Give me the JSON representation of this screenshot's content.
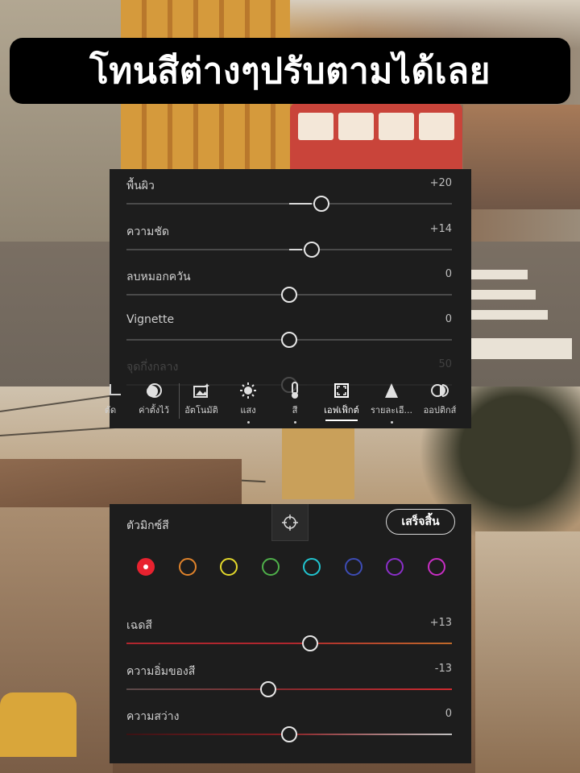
{
  "title": "โทนสีต่างๆปรับตามได้เลย",
  "top_panel": {
    "sliders": [
      {
        "label": "พื้นผิว",
        "value": "+20",
        "level": 20
      },
      {
        "label": "ความชัด",
        "value": "+14",
        "level": 14
      },
      {
        "label": "ลบหมอกควัน",
        "value": "0",
        "level": 0
      },
      {
        "label": "Vignette",
        "value": "0",
        "level": 0
      },
      {
        "label": "จุดกึ่งกลาง",
        "value": "50",
        "level": 0
      }
    ],
    "toolbar": [
      {
        "label": "ตัด",
        "icon": "crop-icon"
      },
      {
        "label": "ค่าตั้งไว้",
        "icon": "presets-icon"
      },
      {
        "label": "อัตโนมัติ",
        "icon": "auto-icon"
      },
      {
        "label": "แสง",
        "icon": "light-icon"
      },
      {
        "label": "สี",
        "icon": "color-icon"
      },
      {
        "label": "เอฟเฟ็กต์",
        "icon": "effects-icon",
        "active": true
      },
      {
        "label": "รายละเอี...",
        "icon": "detail-icon"
      },
      {
        "label": "ออปติกส์",
        "icon": "optics-icon"
      }
    ]
  },
  "bottom_panel": {
    "title": "ตัวมิกซ์สี",
    "target_icon": "target-icon",
    "done_label": "เสร็จสิ้น",
    "swatches": [
      {
        "name": "red",
        "color": "#e8222f",
        "selected": true
      },
      {
        "name": "orange",
        "color": "#e0832b"
      },
      {
        "name": "yellow",
        "color": "#e3d82b"
      },
      {
        "name": "green",
        "color": "#4fb04a"
      },
      {
        "name": "aqua",
        "color": "#21c4cf"
      },
      {
        "name": "blue",
        "color": "#3d4cb5"
      },
      {
        "name": "purple",
        "color": "#8b2fc9"
      },
      {
        "name": "magenta",
        "color": "#c82ec4"
      }
    ],
    "sliders": [
      {
        "label": "เฉดสี",
        "value": "+13",
        "level": 13
      },
      {
        "label": "ความอิ่มของสี",
        "value": "-13",
        "level": -13
      },
      {
        "label": "ความสว่าง",
        "value": "0",
        "level": 0
      }
    ]
  }
}
